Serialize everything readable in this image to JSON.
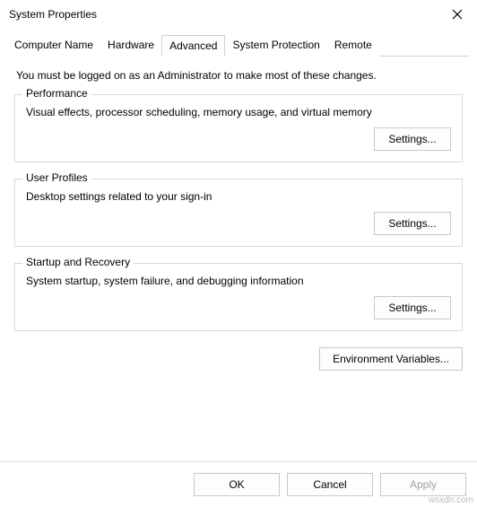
{
  "window": {
    "title": "System Properties"
  },
  "tabs": {
    "items": [
      {
        "label": "Computer Name"
      },
      {
        "label": "Hardware"
      },
      {
        "label": "Advanced"
      },
      {
        "label": "System Protection"
      },
      {
        "label": "Remote"
      }
    ],
    "selected_index": 2
  },
  "admin_note": "You must be logged on as an Administrator to make most of these changes.",
  "groups": {
    "performance": {
      "title": "Performance",
      "desc": "Visual effects, processor scheduling, memory usage, and virtual memory",
      "button": "Settings..."
    },
    "user_profiles": {
      "title": "User Profiles",
      "desc": "Desktop settings related to your sign-in",
      "button": "Settings..."
    },
    "startup": {
      "title": "Startup and Recovery",
      "desc": "System startup, system failure, and debugging information",
      "button": "Settings..."
    }
  },
  "env_button": "Environment Variables...",
  "footer": {
    "ok": "OK",
    "cancel": "Cancel",
    "apply": "Apply"
  },
  "watermark": "wsxdn.com"
}
